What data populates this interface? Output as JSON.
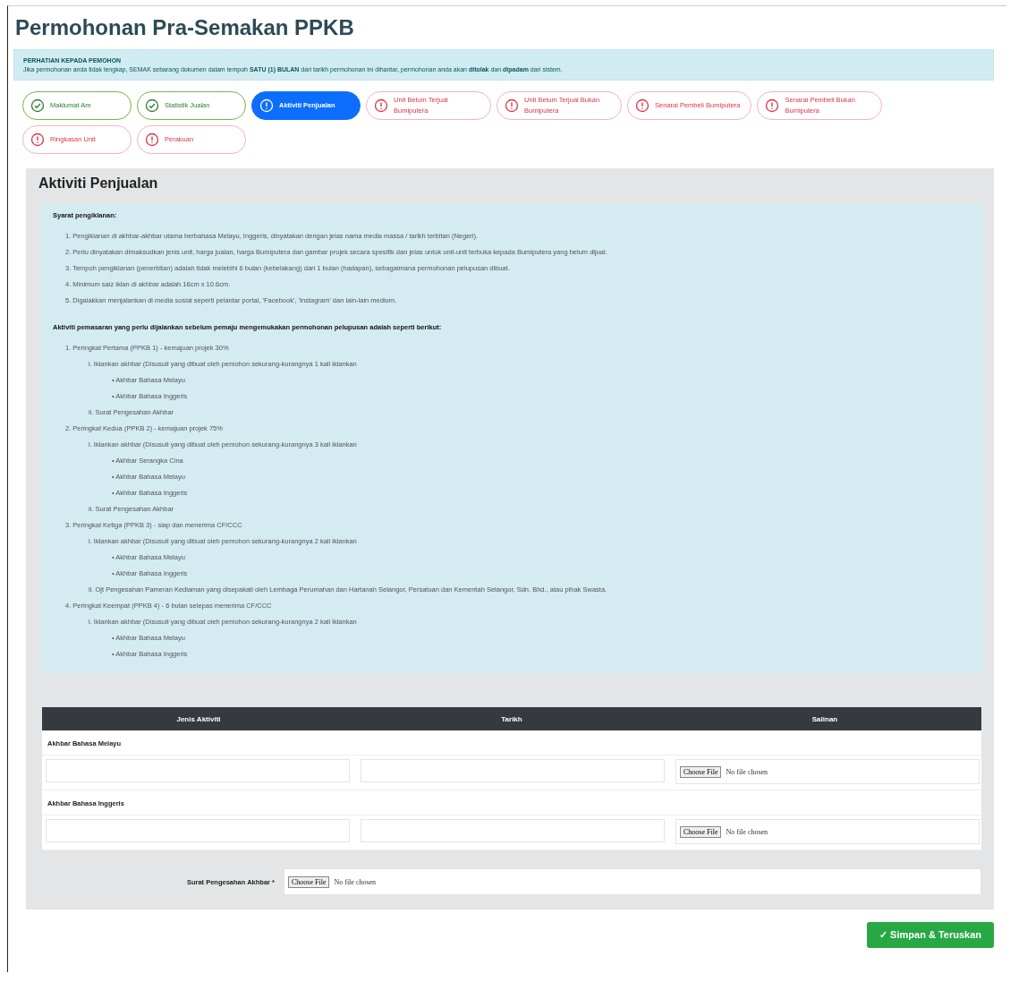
{
  "page_title": "Permohonan Pra-Semakan PPKB",
  "notice": {
    "title": "PERHATIAN KEPADA PEMOHON",
    "text": "Jika permohonan anda tidak lengkap, SEMAK sebarang dokumen dalam tempoh **SATU (1) BULAN** dari tarikh permohonan ini dihantar, permohonan anda akan **ditolak** dan **dipadam** dari sistem."
  },
  "steps": [
    {
      "label": "Maklumat Am",
      "complete": true,
      "selected": false
    },
    {
      "label": "Statistik Jualan",
      "complete": true,
      "selected": false
    },
    {
      "label": "Aktiviti Penjualan",
      "complete": false,
      "selected": true
    },
    {
      "label": "Unit Belum Terjual Bumiputera",
      "complete": false,
      "selected": false
    },
    {
      "label": "Unit Belum Terjual Bukan Bumiputera",
      "complete": false,
      "selected": false
    },
    {
      "label": "Senarai Pembeli Bumiputera",
      "complete": false,
      "selected": false
    },
    {
      "label": "Senarai Pembeli Bukan Bumiputera",
      "complete": false,
      "selected": false
    },
    {
      "label": "Ringkasan Unit",
      "complete": false,
      "selected": false
    },
    {
      "label": "Perakuan",
      "complete": false,
      "selected": false
    }
  ],
  "section": {
    "title": "Aktiviti Penjualan",
    "guide": {
      "heading": "Syarat pengiklanan:",
      "rules": [
        "1. Pengiklanan di akhbar-akhbar utama berbahasa Melayu, Inggeris, dinyatakan dengan jelas nama media massa / tarikh terbitan (Negeri).",
        "2. Perlu dinyatakan dimaksudkan jenis unit, harga jualan, harga Bumiputera dan gambar projek secara spesifik dan jelas untuk unit-unit terbuka kepada Bumiputera yang belum dijual.",
        "3. Tempoh pengiklanan (penerbitan) adalah tidak melebihi 6 bulan (kebelakang) dari 1 bulan (hadapan), sebagaimana permohonan pelupusan dibuat.",
        "4. Minimum saiz iklan di akhbar adalah 16cm x 10.6cm.",
        "5. Digalakkan menjalankan di media sosial seperti pelantar portal, 'Facebook', 'Instagram' dan lain-lain medium."
      ],
      "activities_heading": "Aktiviti pemasaran yang perlu dijalankan sebelum pemaju mengemukakan permohonan pelupusan adalah seperti berikut:",
      "activities": [
        {
          "text": "1. Peringkat Pertama (PPKB 1) - kemajuan projek 30%",
          "children": [
            {
              "text": "i. Iklankan akhbar (Disusuli yang dibuat oleh pemohon sekurang-kurangnya 1 kali iklankan",
              "children": [
                {
                  "text": "• Akhbar Bahasa Melayu"
                },
                {
                  "text": "• Akhbar Bahasa Inggeris"
                }
              ]
            },
            {
              "text": "ii. Surat Pengesahan Akhbar"
            }
          ]
        },
        {
          "text": "2. Peringkat Kedua (PPKB 2) - kemajuan projek 75%",
          "children": [
            {
              "text": "i. Iklankan akhbar (Disusuli yang dibuat oleh pemohon sekurang-kurangnya 3 kali iklankan",
              "children": [
                {
                  "text": "• Akhbar Serangka Cina"
                },
                {
                  "text": "• Akhbar Bahasa Melayu"
                },
                {
                  "text": "• Akhbar Bahasa Inggeris"
                }
              ]
            },
            {
              "text": "ii. Surat Pengesahan Akhbar"
            }
          ]
        },
        {
          "text": "3. Peringkat Ketiga (PPKB 3) - siap dan menerima CF/CCC",
          "children": [
            {
              "text": "i. Iklankan akhbar (Disusuli yang dibuat oleh pemohon sekurang-kurangnya 2 kali iklankan",
              "children": [
                {
                  "text": "• Akhbar Bahasa Melayu"
                },
                {
                  "text": "• Akhbar Bahasa Inggeris"
                }
              ]
            },
            {
              "text": "ii. Ojt Pengesahan Pameran Kediaman yang disepakati oleh Lembaga Perumahan dan Hartanah Selangor, Persatuan dan Kementah Selangor, Sdn. Bhd., atau pihak Swasta."
            }
          ]
        },
        {
          "text": "4. Peringkat Keempat (PPKB 4) - 6 bulan selepas menerima CF/CCC",
          "children": [
            {
              "text": "i. Iklankan akhbar (Disusuli yang dibuat oleh pemohon sekurang-kurangnya 2 kali iklankan",
              "children": [
                {
                  "text": "• Akhbar Bahasa Melayu"
                },
                {
                  "text": "• Akhbar Bahasa Inggeris"
                }
              ]
            }
          ]
        }
      ]
    },
    "table": {
      "columns": [
        "Jenis Aktiviti",
        "Tarikh",
        "Salinan"
      ],
      "groups": [
        {
          "title": "Akhbar Bahasa Melayu",
          "file_button": "Choose File",
          "file_status": "No file chosen"
        },
        {
          "title": "Akhbar Bahasa Inggeris",
          "file_button": "Choose File",
          "file_status": "No file chosen"
        }
      ]
    },
    "letter_field": {
      "label": "Surat Pengesahan Akhbar *",
      "file_button": "Choose File",
      "file_status": "No file chosen"
    }
  },
  "submit_button": "✓ Simpan & Teruskan"
}
